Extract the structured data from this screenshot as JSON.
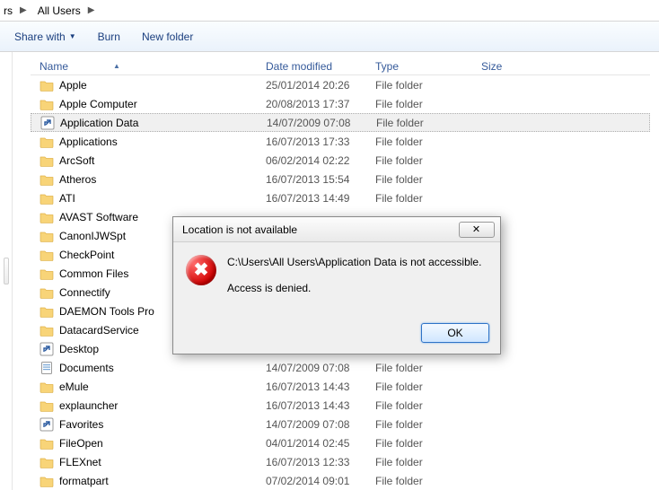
{
  "breadcrumb": {
    "segments": [
      "rs",
      "All Users"
    ]
  },
  "toolbar": {
    "share": "Share with",
    "burn": "Burn",
    "newfolder": "New folder"
  },
  "columns": {
    "name": "Name",
    "date": "Date modified",
    "type": "Type",
    "size": "Size"
  },
  "rows": [
    {
      "icon": "folder",
      "name": "Apple",
      "date": "25/01/2014 20:26",
      "type": "File folder",
      "selected": false
    },
    {
      "icon": "folder",
      "name": "Apple Computer",
      "date": "20/08/2013 17:37",
      "type": "File folder",
      "selected": false
    },
    {
      "icon": "shortcut",
      "name": "Application Data",
      "date": "14/07/2009 07:08",
      "type": "File folder",
      "selected": true
    },
    {
      "icon": "folder",
      "name": "Applications",
      "date": "16/07/2013 17:33",
      "type": "File folder",
      "selected": false
    },
    {
      "icon": "folder",
      "name": "ArcSoft",
      "date": "06/02/2014 02:22",
      "type": "File folder",
      "selected": false
    },
    {
      "icon": "folder",
      "name": "Atheros",
      "date": "16/07/2013 15:54",
      "type": "File folder",
      "selected": false
    },
    {
      "icon": "folder",
      "name": "ATI",
      "date": "16/07/2013 14:49",
      "type": "File folder",
      "selected": false
    },
    {
      "icon": "folder",
      "name": "AVAST Software",
      "date": "",
      "type": "",
      "selected": false
    },
    {
      "icon": "folder",
      "name": "CanonIJWSpt",
      "date": "",
      "type": "",
      "selected": false
    },
    {
      "icon": "folder",
      "name": "CheckPoint",
      "date": "",
      "type": "",
      "selected": false
    },
    {
      "icon": "folder",
      "name": "Common Files",
      "date": "",
      "type": "",
      "selected": false
    },
    {
      "icon": "folder",
      "name": "Connectify",
      "date": "",
      "type": "",
      "selected": false
    },
    {
      "icon": "folder",
      "name": "DAEMON Tools Pro",
      "date": "",
      "type": "",
      "selected": false
    },
    {
      "icon": "folder",
      "name": "DatacardService",
      "date": "",
      "type": "",
      "selected": false
    },
    {
      "icon": "shortcut",
      "name": "Desktop",
      "date": "",
      "type": "",
      "selected": false
    },
    {
      "icon": "doc",
      "name": "Documents",
      "date": "14/07/2009 07:08",
      "type": "File folder",
      "selected": false
    },
    {
      "icon": "folder",
      "name": "eMule",
      "date": "16/07/2013 14:43",
      "type": "File folder",
      "selected": false
    },
    {
      "icon": "folder",
      "name": "explauncher",
      "date": "16/07/2013 14:43",
      "type": "File folder",
      "selected": false
    },
    {
      "icon": "shortcut",
      "name": "Favorites",
      "date": "14/07/2009 07:08",
      "type": "File folder",
      "selected": false
    },
    {
      "icon": "folder",
      "name": "FileOpen",
      "date": "04/01/2014 02:45",
      "type": "File folder",
      "selected": false
    },
    {
      "icon": "folder",
      "name": "FLEXnet",
      "date": "16/07/2013 12:33",
      "type": "File folder",
      "selected": false
    },
    {
      "icon": "folder",
      "name": "formatpart",
      "date": "07/02/2014 09:01",
      "type": "File folder",
      "selected": false
    }
  ],
  "dialog": {
    "title": "Location is not available",
    "line1": "C:\\Users\\All Users\\Application Data is not accessible.",
    "line2": "Access is denied.",
    "ok": "OK"
  }
}
